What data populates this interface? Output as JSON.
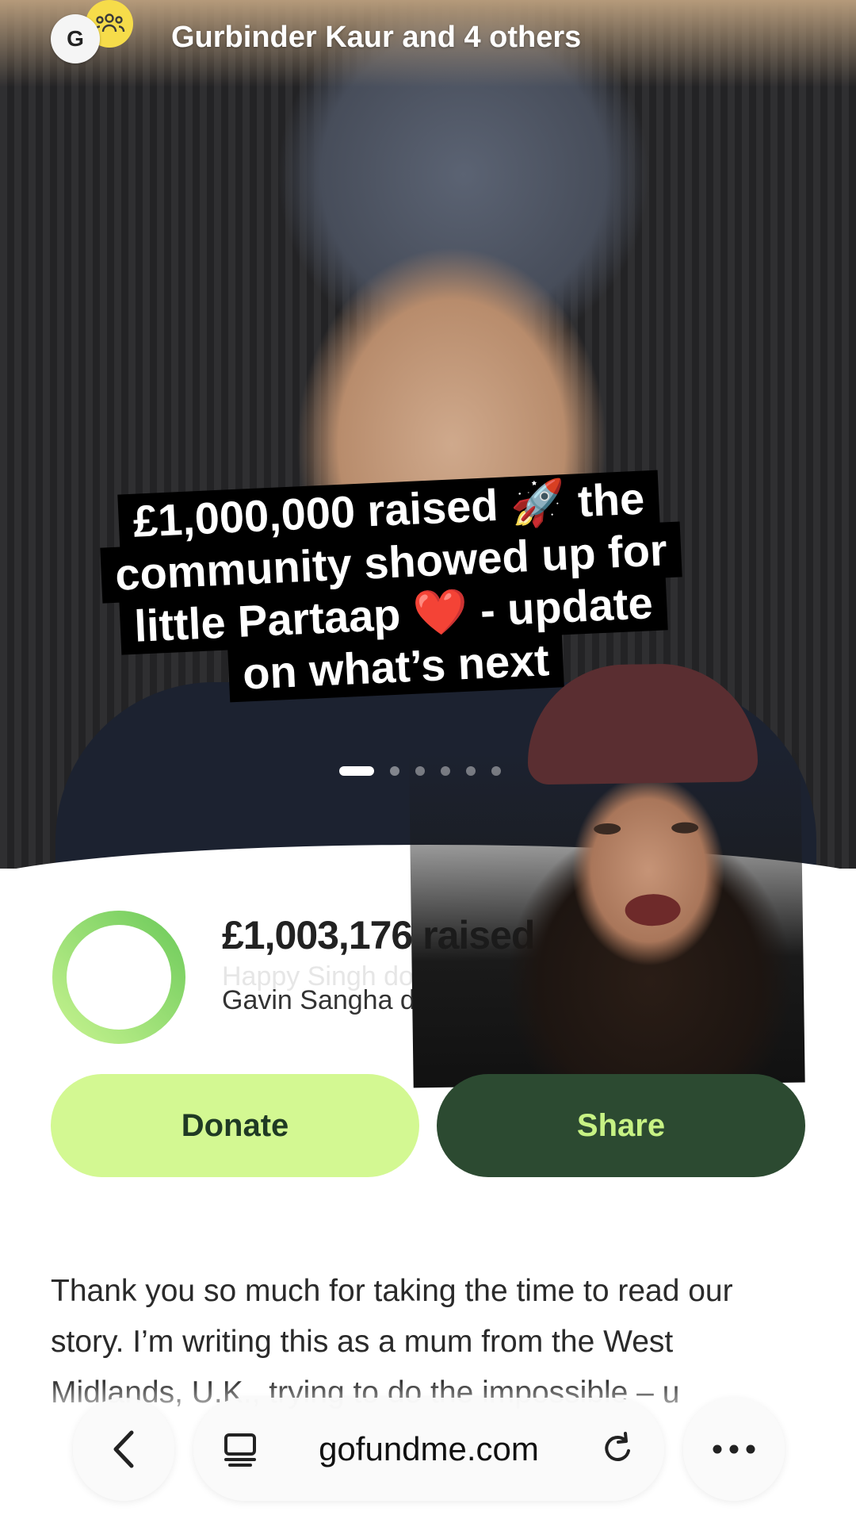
{
  "header": {
    "avatar_letter": "G",
    "title": "Gurbinder Kaur and 4 others"
  },
  "caption": {
    "lines": [
      "£1,000,000 raised 🚀 the",
      "community showed up for",
      "little Partaap ❤️ - update",
      "on what’s next"
    ]
  },
  "carousel": {
    "total": 6,
    "active": 1
  },
  "fundraiser": {
    "raised": "£1,003,176 raised",
    "progress_fraction": 1.0,
    "donor_previous": "Happy Singh donated",
    "donor_current": "Gavin Sangha donated"
  },
  "actions": {
    "donate_label": "Donate",
    "share_label": "Share"
  },
  "story": {
    "text": "Thank you so much for taking the time to read our story. I’m writing this as a mum from the West Midlands, U.K., trying to do the impossible – u"
  },
  "browser": {
    "url": "gofundme.com",
    "icons": [
      "back-icon",
      "tabs-icon",
      "reload-icon",
      "more-icon"
    ]
  },
  "colors": {
    "donate_bg": "#d3f892",
    "share_bg": "#2c4a31",
    "progress_green": "#8fdc6c"
  }
}
